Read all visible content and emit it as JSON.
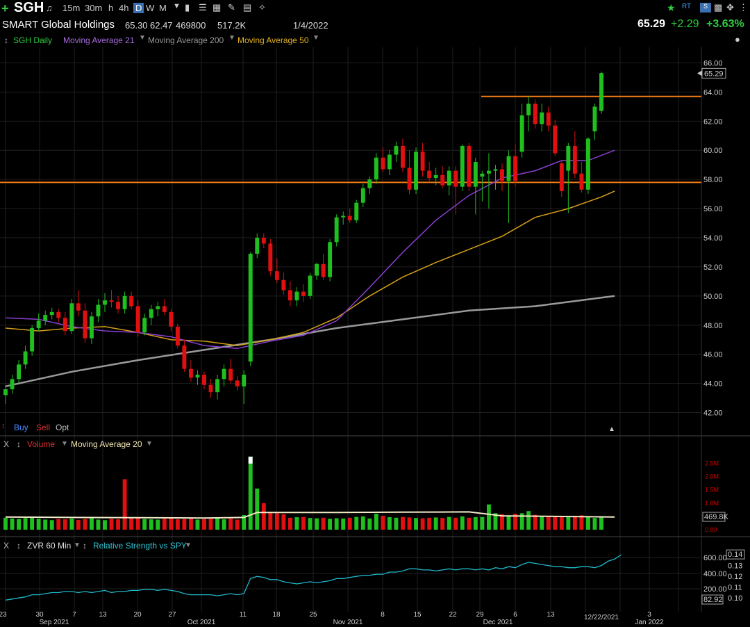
{
  "toolbar": {
    "ticker": "SGH",
    "timeframes": [
      "15m",
      "30m",
      "h",
      "4h",
      "D",
      "W",
      "M"
    ],
    "active_timeframe": "D"
  },
  "info": {
    "company": "SMART Global Holdings",
    "high": "65.30",
    "low": "62.47",
    "volume": "469800",
    "avg_volume": "517.2K",
    "date": "1/4/2022",
    "last": "65.29",
    "change": "+2.29",
    "change_pct": "+3.63%"
  },
  "legend": {
    "series": "SGH Daily",
    "ma21": "Moving Average 21",
    "ma200": "Moving Average 200",
    "ma50": "Moving Average 50"
  },
  "trade_buttons": {
    "buy": "Buy",
    "sell": "Sell",
    "opt": "Opt"
  },
  "volume_pane": {
    "close": "X",
    "title": "Volume",
    "ma": "Moving Average 20",
    "last_label": "469.8K"
  },
  "rs_pane": {
    "close": "X",
    "title": "ZVR 60 Min",
    "indicator": "Relative Strength vs SPY",
    "last_label": "0.14",
    "vol_last": "82.92"
  },
  "colors": {
    "up": "#1fbf1f",
    "down": "#e01010",
    "ma21": "#8a3fd1",
    "ma50": "#d4a017",
    "ma200": "#9a9a9a",
    "hline": "#f07c14",
    "rs": "#1fb8c9"
  },
  "chart_data": [
    {
      "type": "candlestick",
      "title": "SMART Global Holdings",
      "ylim": [
        41.5,
        66.5
      ],
      "yticks": [
        42,
        44,
        46,
        48,
        50,
        52,
        54,
        56,
        58,
        60,
        62,
        64,
        66
      ],
      "ytick_labels": [
        "42.00",
        "44.00",
        "46.00",
        "48.00",
        "50.00",
        "52.00",
        "54.00",
        "56.00",
        "58.00",
        "60.00",
        "62.00",
        "64.00",
        "66.00"
      ],
      "last_price_label": "65.29",
      "x_tick_labels": [
        "23",
        "30",
        "7",
        "13",
        "20",
        "27",
        "Oct 2021",
        "11",
        "18",
        "25",
        "Nov 2021",
        "8",
        "15",
        "22",
        "29",
        "Dec 2021",
        "6",
        "13",
        "12/22/2021",
        "3",
        "Jan 2022"
      ],
      "month_labels": [
        "Sep 2021",
        "Oct 2021",
        "Nov 2021",
        "Dec 2021",
        "Jan 2022"
      ],
      "horizontal_lines": [
        57.8,
        63.7
      ],
      "ohlc": [
        [
          43.2,
          43.9,
          42.6,
          43.6
        ],
        [
          43.6,
          44.6,
          43.3,
          44.3
        ],
        [
          44.3,
          45.6,
          44.0,
          45.3
        ],
        [
          45.3,
          46.6,
          45.0,
          46.2
        ],
        [
          46.2,
          48.0,
          45.9,
          47.8
        ],
        [
          47.8,
          48.8,
          47.6,
          48.3
        ],
        [
          48.3,
          49.0,
          48.0,
          48.7
        ],
        [
          48.7,
          49.2,
          48.4,
          48.9
        ],
        [
          48.9,
          49.1,
          48.2,
          48.5
        ],
        [
          48.5,
          48.9,
          47.3,
          47.6
        ],
        [
          47.6,
          49.8,
          47.4,
          49.5
        ],
        [
          49.5,
          50.4,
          48.6,
          49.0
        ],
        [
          49.0,
          49.5,
          46.8,
          47.1
        ],
        [
          47.1,
          48.9,
          46.7,
          48.6
        ],
        [
          48.6,
          49.8,
          48.2,
          49.4
        ],
        [
          49.4,
          50.2,
          48.9,
          49.7
        ],
        [
          49.7,
          50.4,
          49.2,
          49.6
        ],
        [
          49.6,
          50.0,
          48.8,
          49.1
        ],
        [
          49.1,
          50.3,
          48.8,
          50.0
        ],
        [
          50.0,
          50.3,
          49.1,
          49.3
        ],
        [
          49.3,
          49.7,
          47.2,
          47.5
        ],
        [
          47.5,
          48.8,
          47.3,
          48.5
        ],
        [
          48.5,
          49.4,
          48.0,
          49.1
        ],
        [
          49.1,
          49.6,
          48.6,
          49.3
        ],
        [
          49.3,
          49.8,
          48.7,
          48.9
        ],
        [
          48.9,
          49.1,
          47.6,
          47.9
        ],
        [
          47.9,
          48.1,
          46.4,
          46.6
        ],
        [
          46.6,
          47.0,
          44.8,
          45.0
        ],
        [
          45.0,
          45.6,
          44.1,
          44.4
        ],
        [
          44.4,
          44.9,
          43.9,
          44.6
        ],
        [
          44.6,
          44.8,
          43.6,
          43.9
        ],
        [
          43.9,
          44.3,
          43.0,
          43.4
        ],
        [
          43.4,
          44.6,
          42.9,
          44.3
        ],
        [
          44.3,
          45.3,
          43.8,
          45.0
        ],
        [
          45.0,
          45.7,
          44.0,
          44.2
        ],
        [
          44.2,
          44.5,
          43.5,
          43.8
        ],
        [
          43.8,
          44.9,
          42.6,
          44.6
        ],
        [
          45.5,
          53.0,
          45.2,
          52.9
        ],
        [
          52.9,
          54.3,
          52.6,
          54.0
        ],
        [
          54.0,
          54.3,
          53.3,
          53.6
        ],
        [
          53.6,
          53.9,
          51.4,
          51.7
        ],
        [
          51.7,
          52.6,
          50.9,
          51.1
        ],
        [
          51.1,
          51.6,
          50.1,
          50.4
        ],
        [
          50.4,
          51.0,
          49.3,
          49.7
        ],
        [
          49.7,
          50.6,
          49.3,
          50.3
        ],
        [
          50.3,
          50.8,
          49.6,
          50.0
        ],
        [
          50.0,
          51.6,
          49.8,
          51.4
        ],
        [
          51.4,
          52.3,
          51.1,
          52.2
        ],
        [
          52.2,
          52.9,
          51.1,
          51.3
        ],
        [
          51.3,
          53.9,
          51.0,
          53.7
        ],
        [
          53.7,
          55.6,
          53.4,
          55.4
        ],
        [
          55.4,
          55.8,
          54.9,
          55.5
        ],
        [
          55.5,
          56.0,
          55.0,
          55.2
        ],
        [
          55.2,
          56.6,
          55.0,
          56.4
        ],
        [
          56.4,
          57.7,
          56.1,
          57.4
        ],
        [
          57.4,
          58.2,
          57.0,
          58.0
        ],
        [
          58.0,
          59.8,
          57.7,
          59.5
        ],
        [
          59.5,
          60.2,
          58.5,
          58.7
        ],
        [
          58.7,
          60.0,
          58.3,
          59.7
        ],
        [
          59.7,
          60.6,
          59.2,
          60.3
        ],
        [
          60.3,
          60.8,
          58.5,
          58.8
        ],
        [
          58.8,
          60.0,
          57.0,
          57.3
        ],
        [
          57.3,
          60.2,
          57.0,
          59.9
        ],
        [
          59.9,
          60.5,
          58.2,
          58.6
        ],
        [
          58.6,
          59.2,
          57.8,
          58.1
        ],
        [
          58.1,
          58.8,
          57.6,
          58.3
        ],
        [
          58.3,
          58.9,
          57.4,
          57.6
        ],
        [
          57.6,
          58.9,
          56.9,
          58.6
        ],
        [
          58.6,
          58.9,
          55.6,
          57.5
        ],
        [
          57.5,
          60.4,
          57.2,
          60.3
        ],
        [
          60.3,
          60.5,
          57.2,
          57.5
        ],
        [
          57.5,
          59.5,
          55.6,
          59.2
        ],
        [
          58.2,
          58.6,
          56.5,
          58.4
        ],
        [
          58.4,
          59.8,
          56.0,
          58.6
        ],
        [
          58.6,
          59.0,
          57.3,
          58.7
        ],
        [
          58.7,
          59.1,
          57.2,
          57.9
        ],
        [
          57.9,
          60.0,
          55.0,
          59.6
        ],
        [
          59.6,
          60.4,
          57.5,
          57.9
        ],
        [
          59.9,
          63.2,
          59.5,
          62.4
        ],
        [
          62.4,
          63.7,
          61.3,
          63.2
        ],
        [
          63.2,
          63.5,
          61.5,
          61.8
        ],
        [
          61.8,
          63.2,
          61.3,
          62.6
        ],
        [
          62.6,
          63.0,
          61.3,
          61.7
        ],
        [
          61.7,
          62.1,
          59.6,
          59.8
        ],
        [
          59.1,
          59.3,
          56.8,
          57.2
        ],
        [
          58.6,
          60.5,
          55.7,
          60.3
        ],
        [
          60.3,
          61.3,
          58.1,
          58.4
        ],
        [
          58.4,
          59.2,
          57.1,
          57.3
        ],
        [
          57.3,
          60.9,
          57.0,
          60.8
        ],
        [
          61.3,
          63.2,
          60.7,
          63.0
        ],
        [
          62.7,
          65.4,
          62.5,
          65.3
        ]
      ],
      "ma21": [
        [
          0,
          48.5
        ],
        [
          5,
          48.4
        ],
        [
          10,
          47.9
        ],
        [
          15,
          47.6
        ],
        [
          20,
          47.5
        ],
        [
          25,
          47.2
        ],
        [
          30,
          46.6
        ],
        [
          35,
          46.4
        ],
        [
          40,
          46.9
        ],
        [
          45,
          47.3
        ],
        [
          50,
          48.3
        ],
        [
          55,
          50.6
        ],
        [
          60,
          53.0
        ],
        [
          65,
          55.2
        ],
        [
          70,
          56.9
        ],
        [
          75,
          58.1
        ],
        [
          80,
          58.6
        ],
        [
          84,
          59.3
        ],
        [
          88,
          59.3
        ],
        [
          92,
          60.0
        ]
      ],
      "ma50": [
        [
          0,
          47.8
        ],
        [
          5,
          47.6
        ],
        [
          10,
          47.8
        ],
        [
          15,
          47.9
        ],
        [
          20,
          47.5
        ],
        [
          25,
          47.0
        ],
        [
          30,
          46.9
        ],
        [
          35,
          46.6
        ],
        [
          40,
          47.0
        ],
        [
          45,
          47.5
        ],
        [
          50,
          48.5
        ],
        [
          55,
          50.0
        ],
        [
          60,
          51.3
        ],
        [
          65,
          52.3
        ],
        [
          70,
          53.2
        ],
        [
          75,
          54.1
        ],
        [
          80,
          55.4
        ],
        [
          85,
          56.0
        ],
        [
          90,
          56.8
        ],
        [
          92,
          57.2
        ]
      ],
      "ma200": [
        [
          0,
          43.8
        ],
        [
          10,
          44.8
        ],
        [
          20,
          45.6
        ],
        [
          30,
          46.3
        ],
        [
          40,
          47.0
        ],
        [
          50,
          47.8
        ],
        [
          60,
          48.4
        ],
        [
          70,
          49.0
        ],
        [
          80,
          49.3
        ],
        [
          92,
          50.0
        ]
      ]
    },
    {
      "type": "bar",
      "title": "Volume",
      "ylim": [
        0,
        2.8
      ],
      "ytick_labels": [
        "0.00",
        "469.8K",
        "1.0M",
        "1.5M",
        "2.0M",
        "2.5M"
      ],
      "unit": "M",
      "values": [
        0.45,
        0.42,
        0.4,
        0.44,
        0.46,
        0.41,
        0.38,
        0.36,
        0.4,
        0.39,
        0.42,
        0.37,
        0.4,
        0.43,
        0.38,
        0.36,
        0.41,
        0.39,
        0.4,
        0.45,
        0.44,
        0.4,
        0.39,
        0.38,
        0.41,
        0.42,
        0.39,
        0.4,
        0.42,
        0.38,
        0.4,
        0.41,
        0.43,
        0.39,
        0.42,
        0.38,
        0.55,
        2.75,
        1.55,
        1.0,
        0.65,
        0.62,
        0.58,
        0.45,
        0.47,
        0.48,
        0.44,
        0.43,
        0.45,
        0.41,
        0.43,
        0.42,
        0.45,
        0.48,
        0.5,
        0.42,
        0.6,
        0.52,
        0.47,
        0.45,
        0.48,
        0.46,
        0.44,
        0.43,
        0.45,
        0.46,
        0.44,
        0.48,
        0.45,
        0.5,
        0.45,
        0.47,
        0.48,
        0.95,
        0.62,
        0.58,
        0.5,
        0.6,
        0.62,
        0.7,
        0.56,
        0.52,
        0.49,
        0.48,
        0.5,
        0.47,
        0.52,
        0.54,
        0.48,
        0.44,
        0.46,
        0.9,
        0.55,
        0.47
      ],
      "highlight_index": 18,
      "highlight_value": 1.9,
      "ma20": [
        [
          0,
          0.48
        ],
        [
          10,
          0.46
        ],
        [
          20,
          0.45
        ],
        [
          30,
          0.44
        ],
        [
          36,
          0.46
        ],
        [
          38,
          0.65
        ],
        [
          50,
          0.65
        ],
        [
          60,
          0.66
        ],
        [
          70,
          0.67
        ],
        [
          75,
          0.52
        ],
        [
          92,
          0.48
        ]
      ]
    },
    {
      "type": "line",
      "title": "Relative Strength vs SPY",
      "ylim": [
        0.095,
        0.142
      ],
      "yticks_right": [
        "0.10",
        "0.11",
        "0.12",
        "0.13",
        "0.14"
      ],
      "yticks_left": [
        "200.00",
        "400.00",
        "600.00"
      ],
      "values": [
        0.098,
        0.099,
        0.1,
        0.101,
        0.103,
        0.103,
        0.104,
        0.105,
        0.105,
        0.106,
        0.106,
        0.105,
        0.106,
        0.105,
        0.106,
        0.107,
        0.105,
        0.106,
        0.106,
        0.107,
        0.107,
        0.108,
        0.108,
        0.107,
        0.108,
        0.107,
        0.106,
        0.104,
        0.103,
        0.103,
        0.103,
        0.103,
        0.102,
        0.103,
        0.104,
        0.103,
        0.104,
        0.118,
        0.12,
        0.119,
        0.117,
        0.117,
        0.115,
        0.114,
        0.113,
        0.114,
        0.115,
        0.114,
        0.115,
        0.116,
        0.118,
        0.118,
        0.119,
        0.12,
        0.121,
        0.121,
        0.122,
        0.122,
        0.124,
        0.124,
        0.125,
        0.127,
        0.127,
        0.126,
        0.126,
        0.125,
        0.126,
        0.127,
        0.126,
        0.127,
        0.127,
        0.126,
        0.127,
        0.126,
        0.128,
        0.127,
        0.129,
        0.128,
        0.131,
        0.133,
        0.132,
        0.131,
        0.13,
        0.129,
        0.129,
        0.128,
        0.128,
        0.129,
        0.129,
        0.128,
        0.13,
        0.134,
        0.136,
        0.14
      ]
    }
  ]
}
